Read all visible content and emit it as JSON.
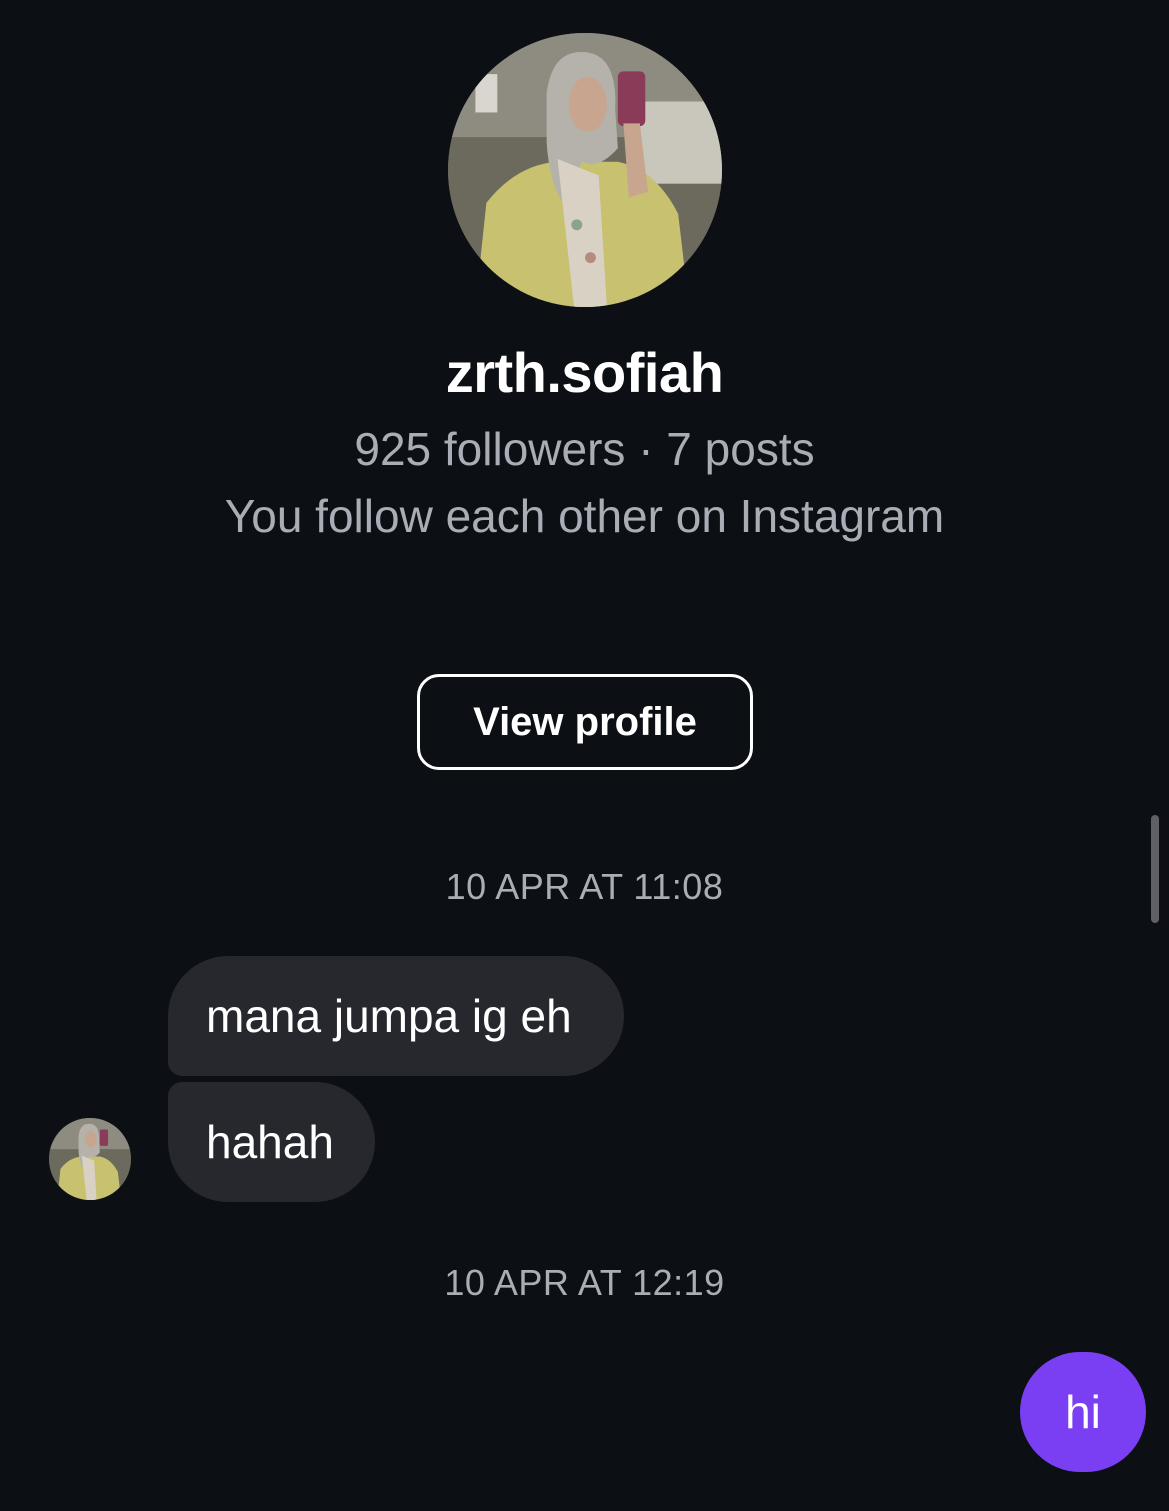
{
  "profile": {
    "username": "zrth.sofiah",
    "stats": "925 followers · 7 posts",
    "follow_note": "You follow each other on Instagram",
    "view_profile_label": "View profile"
  },
  "messages": {
    "timestamp_1": "10 APR AT 11:08",
    "incoming_1": "mana jumpa ig eh",
    "incoming_2": "hahah",
    "timestamp_2": "10 APR AT 12:19",
    "outgoing_1": "hi"
  },
  "colors": {
    "background": "#0c0f14",
    "incoming_bubble": "#26282e",
    "outgoing_bubble": "#7a3ff2",
    "secondary_text": "#a9adb5"
  },
  "icons": {
    "profile_photo": "avatar-photo",
    "small_avatar": "avatar-photo"
  }
}
